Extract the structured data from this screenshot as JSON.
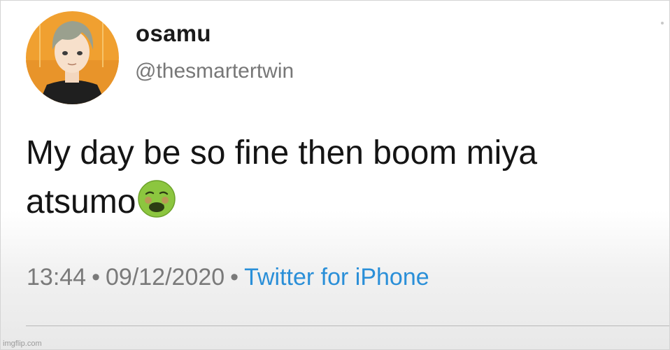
{
  "tweet": {
    "display_name": "osamu",
    "handle": "@thesmartertwin",
    "text_line1": "My day be so fine then boom miya",
    "text_line2": "atsumo",
    "emoji": "nauseated-face-emoji",
    "time": "13:44",
    "separator": "•",
    "date": "09/12/2020",
    "source": "Twitter for iPhone"
  },
  "watermark": "imgflip.com",
  "colors": {
    "source_link": "#2a8fd8",
    "avatar_background": "#f0a030",
    "emoji_face": "#8cc63f"
  },
  "icons": {
    "avatar": "profile-avatar-image",
    "emoji": "nauseated-face-emoji"
  }
}
